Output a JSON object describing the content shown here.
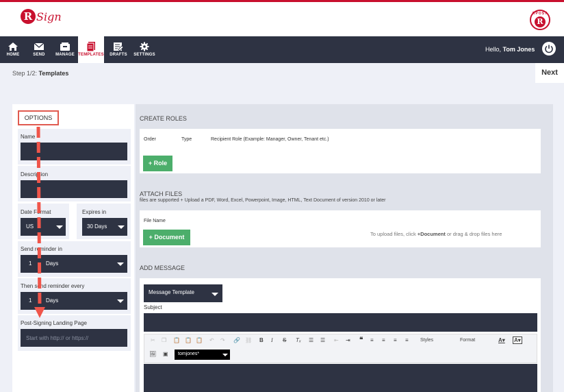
{
  "brand": {
    "logo_letter": "R",
    "logo_text": "Sign",
    "seal_top": "RPOST",
    "seal_letter": "R"
  },
  "nav": {
    "items": [
      {
        "label": "HOME",
        "icon": "home-icon"
      },
      {
        "label": "SEND",
        "icon": "envelope-icon"
      },
      {
        "label": "MANAGE",
        "icon": "inbox-icon"
      },
      {
        "label": "TEMPLATES",
        "icon": "templates-icon",
        "active": true
      },
      {
        "label": "DRAFTS",
        "icon": "drafts-icon"
      },
      {
        "label": "SETTINGS",
        "icon": "gear-icon"
      }
    ],
    "greeting_prefix": "Hello,",
    "user_name": "Tom Jones"
  },
  "step": {
    "prefix": "Step 1/2:",
    "name": "Templates",
    "next_label": "Next"
  },
  "options": {
    "title": "OPTIONS",
    "name_label": "Name",
    "description_label": "Description",
    "date_format_label": "Date Format",
    "date_format_value": "US",
    "expires_label": "Expires in",
    "expires_value": "30 Days",
    "reminder_label": "Send reminder in",
    "reminder_count": "1",
    "reminder_unit": "Days",
    "then_label": "Then send reminder every",
    "then_count": "1",
    "then_unit": "Days",
    "landing_label": "Post-Signing Landing Page",
    "landing_placeholder": "Start with http:// or https://"
  },
  "roles": {
    "title": "CREATE ROLES",
    "col_order": "Order",
    "col_type": "Type",
    "col_role": "Recipient Role (Example: Manager, Owner, Tenant etc.)",
    "add_label": "+ Role"
  },
  "files": {
    "title": "ATTACH FILES",
    "subtitle": "files are supported + Upload a PDF, Word, Excel, Powerpoint, Image, HTML, Text Document of version 2010 or later",
    "col_name": "File Name",
    "add_label": "+ Document",
    "hint_prefix": "To upload files, click",
    "hint_bold": "+Document",
    "hint_suffix": "or drag & drop files here"
  },
  "message": {
    "title": "ADD MESSAGE",
    "template_label": "Message Template",
    "subject_label": "Subject",
    "styles_label": "Styles",
    "format_label": "Format",
    "font_color_label": "A",
    "bg_color_label": "A",
    "signature_value": "tomjones*"
  },
  "colors": {
    "accent": "#c8102e",
    "navbar": "#2e3343",
    "green": "#4cae6b",
    "annotation": "#f0554a"
  }
}
